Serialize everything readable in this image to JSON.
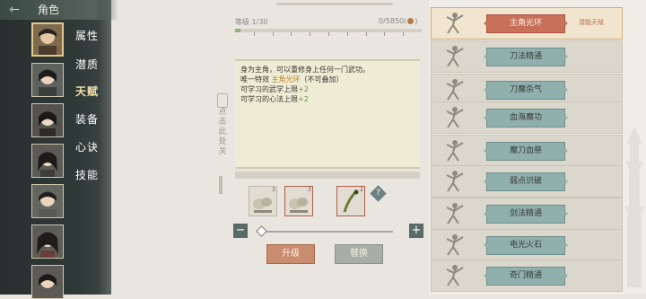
{
  "header": {
    "title": "角色"
  },
  "tabs": [
    "属性",
    "潜质",
    "天赋",
    "装备",
    "心诀",
    "技能"
  ],
  "selected_tab": "天赋",
  "level": {
    "label": "等级",
    "value": "1/30",
    "progress": 0.03
  },
  "experience": {
    "text": "0/5850(",
    "text_end": ")"
  },
  "description": {
    "line1": "身为主角，可以重修身上任何一门武功。",
    "line2_prefix": "唯一特效 ",
    "line2_highlight": "主角光环",
    "line2_suffix": "（不可叠加）",
    "line3_prefix": "可学习的武学上限",
    "line3_value": "+2",
    "line4_prefix": "可学习的心法上限",
    "line4_value": "+2"
  },
  "side_note": [
    "点",
    "击",
    "此",
    "处",
    "关"
  ],
  "items": [
    {
      "count": "3"
    },
    {
      "count": "3"
    },
    {
      "count": "2"
    }
  ],
  "help_label": "?",
  "stepper": {
    "minus": "−",
    "plus": "+"
  },
  "buttons": {
    "upgrade": "升级",
    "replace": "替换"
  },
  "talents": [
    {
      "name": "主角光环",
      "tag": "潜能天赋",
      "selected": true
    },
    {
      "name": "刀法精通",
      "tag": "",
      "selected": false
    },
    {
      "name": "刀魔杀气",
      "tag": "",
      "selected": false
    },
    {
      "name": "血海魔功",
      "tag": "",
      "selected": false
    },
    {
      "name": "魔刀血祭",
      "tag": "",
      "selected": false
    },
    {
      "name": "弱点识破",
      "tag": "",
      "selected": false
    },
    {
      "name": "剑法精通",
      "tag": "",
      "selected": false
    },
    {
      "name": "电光火石",
      "tag": "",
      "selected": false
    },
    {
      "name": "奇门精通",
      "tag": "",
      "selected": false
    }
  ],
  "colors": {
    "selected_talent": "#c9705b",
    "talent_button": "#8fb0ad",
    "upgrade_button": "#c98c6f",
    "replace_button": "#a7aea6",
    "highlight_text": "#b8822a",
    "bonus_text": "#5a9a3c"
  },
  "icons": [
    "back-arrow-icon",
    "coin-icon",
    "help-icon",
    "minus-icon",
    "plus-icon",
    "martial-figure-icon"
  ]
}
